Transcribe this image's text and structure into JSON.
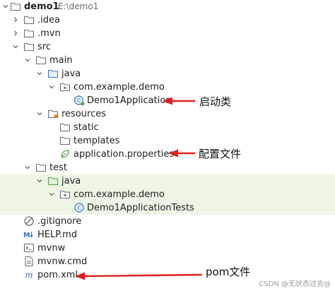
{
  "project": {
    "name": "demo1",
    "path": "E:\\demo1"
  },
  "tree": {
    "idea": ".idea",
    "mvn": ".mvn",
    "src": "src",
    "main": "main",
    "main_java": "java",
    "main_pkg": "com.example.demo",
    "app_class": "Demo1Application",
    "resources": "resources",
    "static": "static",
    "templates": "templates",
    "app_props": "application.properties",
    "test": "test",
    "test_java": "java",
    "test_pkg": "com.example.demo",
    "test_class": "Demo1ApplicationTests",
    "gitignore": ".gitignore",
    "help": "HELP.md",
    "mvnw": "mvnw",
    "mvnw_cmd": "mvnw.cmd",
    "pom": "pom.xml"
  },
  "annotations": {
    "startup_class": "启动类",
    "config_file": "配置文件",
    "pom_file": "pom文件"
  },
  "watermark": "CSDN @无状态过去@",
  "colors": {
    "arrow": "#e02020",
    "highlight": "#edf5e4"
  }
}
